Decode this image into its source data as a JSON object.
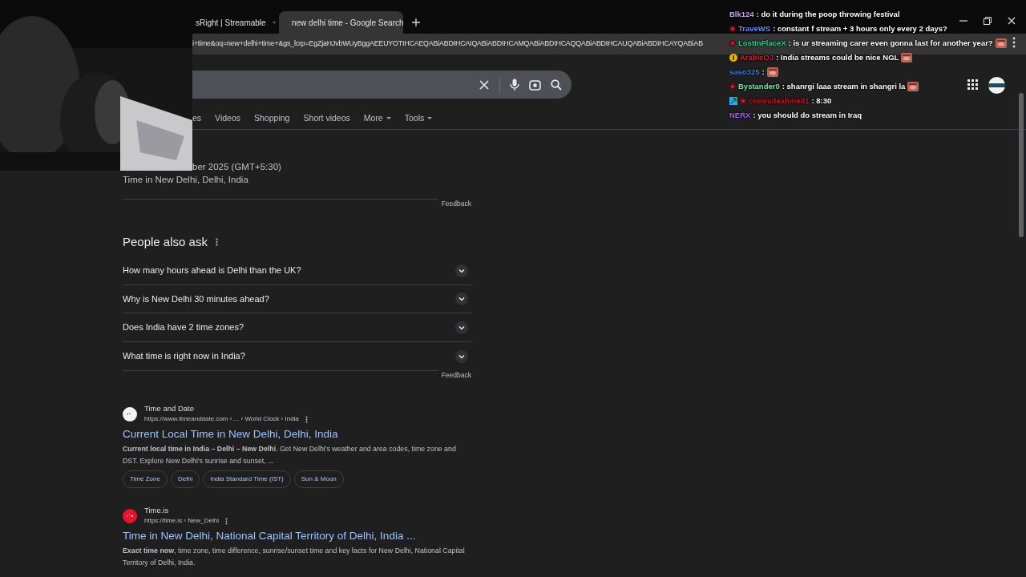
{
  "browser": {
    "tabs": [
      {
        "title": "sRight | Streamable",
        "selected": false
      },
      {
        "title": "new delhi time - Google Search",
        "selected": true
      }
    ],
    "url": "i+time&oq=new+delhi+time+&gs_lcrp=EgZjaHJvbWUyBggAEEUYOTIHCAEQABiABDIHCAIQABiABDIHCAMQABiABDIHCAQQABiABDIHCAUQABiABDIHCAYQABiAB"
  },
  "search": {
    "filters": [
      {
        "label": "es",
        "dropdown": false
      },
      {
        "label": "Videos",
        "dropdown": false
      },
      {
        "label": "Shopping",
        "dropdown": false
      },
      {
        "label": "Short videos",
        "dropdown": false
      },
      {
        "label": "More",
        "dropdown": true
      },
      {
        "label": "Tools",
        "dropdown": true
      }
    ]
  },
  "time_card": {
    "date": "ber 2025 (GMT+5:30)",
    "place": "Time in New Delhi, Delhi, India",
    "feedback": "Feedback"
  },
  "people_also_ask": {
    "title": "People also ask",
    "questions": [
      {
        "text": "How many hours ahead is Delhi than the UK?",
        "expanded": false
      },
      {
        "text": "Why is New Delhi 30 minutes ahead?",
        "expanded": false
      },
      {
        "text": "Does India have 2 time zones?",
        "expanded": false
      },
      {
        "text": "What time is right now in India?",
        "expanded": false
      }
    ],
    "feedback": "Feedback"
  },
  "results": [
    {
      "site": "Time and Date",
      "color": "#f1f3f4",
      "path": "https://www.timeanddate.com › ... › World Clock › India",
      "title": "Current Local Time in New Delhi, Delhi, India",
      "snippet": "**Current local time in India – Delhi – New Delhi**. Get New Delhi's weather and area codes, time zone and DST. Explore New Delhi's sunrise and sunset, ...",
      "chips": [
        "Time Zone",
        "Delhi",
        "India Standard Time (IST)",
        "Sun & Moon"
      ]
    },
    {
      "site": "Time.is",
      "color": "#e8142d",
      "path": "https://time.is › New_Delhi",
      "title": "Time in New Delhi, National Capital Territory of Delhi, India ...",
      "snippet": "**Exact time now**, time zone, time difference, sunrise/sunset time and key facts for New Delhi, National Capital Territory of Delhi, India."
    }
  ],
  "chat": [
    {
      "user": "Blk124",
      "color": "#c9a3ea",
      "message": ": do it during the poop throwing festival",
      "emote": false
    },
    {
      "user": "TraveWS",
      "color": "#6b8cff",
      "badges": [
        {
          "kind": "dot"
        }
      ],
      "message": ": constant f stream + 3 hours only every 2 days?",
      "emote": false
    },
    {
      "user": "LostInPlaceX",
      "color": "#35c98f",
      "badges": [
        {
          "kind": "dot"
        }
      ],
      "message": ": is ur streaming carer even gonna last for another year?",
      "emote": true
    },
    {
      "user": "ArabicOJ",
      "color": "#d0203a",
      "badges": [
        {
          "kind": "coin"
        }
      ],
      "message": ": India streams could be nice NGL",
      "emote": true
    },
    {
      "user": "saso325",
      "color": "#3b7ddd",
      "message": ":",
      "emote": true
    },
    {
      "user": "Bystander0",
      "color": "#7fe3b4",
      "badges": [
        {
          "kind": "dot"
        }
      ],
      "message": ": shanrgi laaa stream in shangri la",
      "emote": true
    },
    {
      "user": "comradeahmed1",
      "color": "#c8102e",
      "badges": [
        {
          "kind": "square"
        },
        {
          "kind": "dot"
        }
      ],
      "message": ": 8:30",
      "emote": false
    },
    {
      "user": "NERX",
      "color": "#a55cff",
      "message": ": you should do stream in Iraq",
      "emote": false
    }
  ]
}
